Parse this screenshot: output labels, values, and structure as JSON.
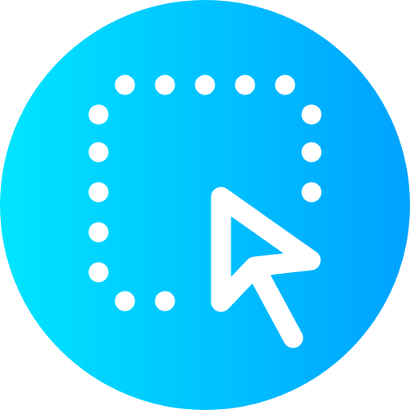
{
  "icon": {
    "name": "selection-cursor-icon",
    "gradient_start": "#00E5FF",
    "gradient_end": "#00A2FF",
    "foreground": "#FFFFFF"
  }
}
